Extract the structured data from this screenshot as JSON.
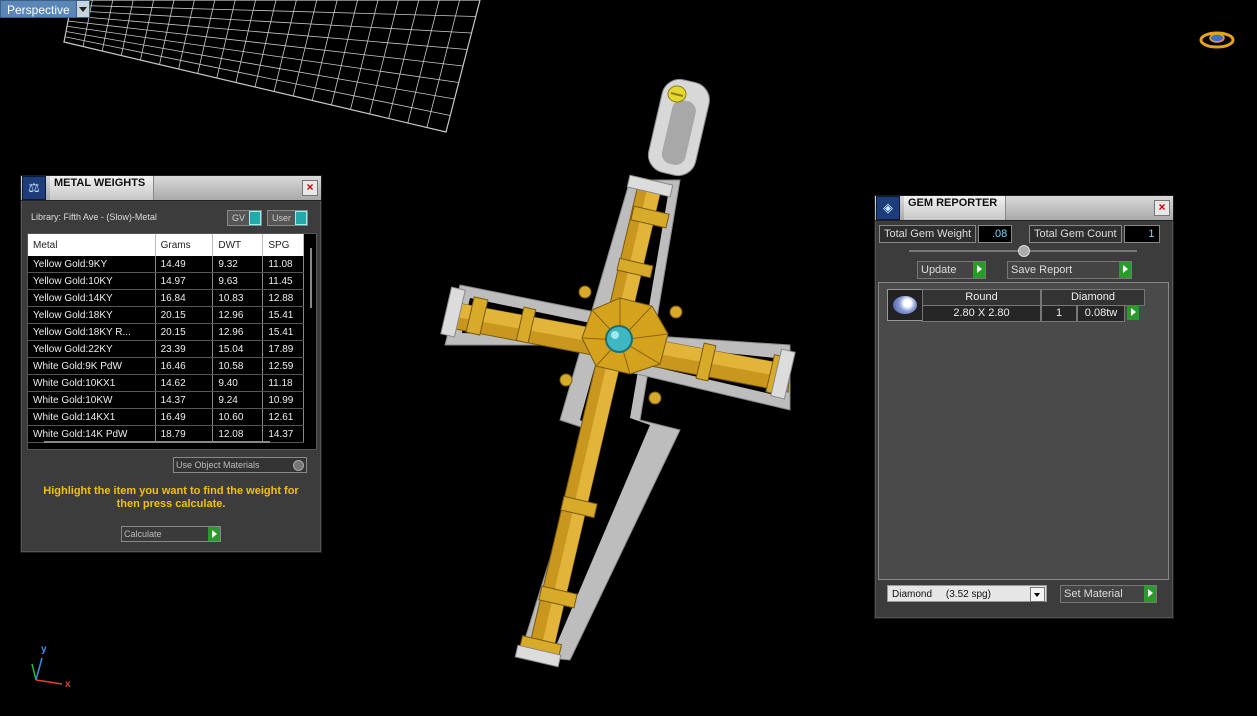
{
  "viewport": {
    "label": "Perspective"
  },
  "metal_weights": {
    "title": "METAL WEIGHTS",
    "library": "Library: Fifth Ave - (Slow)-Metal",
    "toggle_gv": "GV",
    "toggle_user": "User",
    "columns": [
      "Metal",
      "Grams",
      "DWT",
      "SPG"
    ],
    "rows": [
      [
        "Yellow Gold:9KY",
        "14.49",
        "9.32",
        "11.08"
      ],
      [
        "Yellow Gold:10KY",
        "14.97",
        "9.63",
        "11.45"
      ],
      [
        "Yellow Gold:14KY",
        "16.84",
        "10.83",
        "12.88"
      ],
      [
        "Yellow Gold:18KY",
        "20.15",
        "12.96",
        "15.41"
      ],
      [
        "Yellow Gold:18KY R...",
        "20.15",
        "12.96",
        "15.41"
      ],
      [
        "Yellow Gold:22KY",
        "23.39",
        "15.04",
        "17.89"
      ],
      [
        "White Gold:9K PdW",
        "16.46",
        "10.58",
        "12.59"
      ],
      [
        "White Gold:10KX1",
        "14.62",
        "9.40",
        "11.18"
      ],
      [
        "White Gold:10KW",
        "14.37",
        "9.24",
        "10.99"
      ],
      [
        "White Gold:14KX1",
        "16.49",
        "10.60",
        "12.61"
      ],
      [
        "White Gold:14K PdW",
        "18.79",
        "12.08",
        "14.37"
      ]
    ],
    "use_object_materials": "Use Object Materials",
    "hint": "Highlight the item you want to find the weight for then press calculate.",
    "calculate": "Calculate"
  },
  "gem_reporter": {
    "title": "GEM REPORTER",
    "total_weight_label": "Total Gem Weight",
    "total_weight_value": ".08",
    "total_count_label": "Total Gem Count",
    "total_count_value": "1",
    "update": "Update",
    "save_report": "Save Report",
    "gem": {
      "shape": "Round",
      "material": "Diamond",
      "size": "2.80 X 2.80",
      "count": "1",
      "weight": "0.08tw"
    },
    "material_select": "Diamond     (3.52 spg)",
    "set_material": "Set Material"
  },
  "axes": {
    "x": "x",
    "y": "y"
  },
  "colors": {
    "gold": "#d4a21d",
    "silver": "#c8c8c8",
    "gem": "#3fb7c2",
    "go_button": "#2a9b2a"
  }
}
